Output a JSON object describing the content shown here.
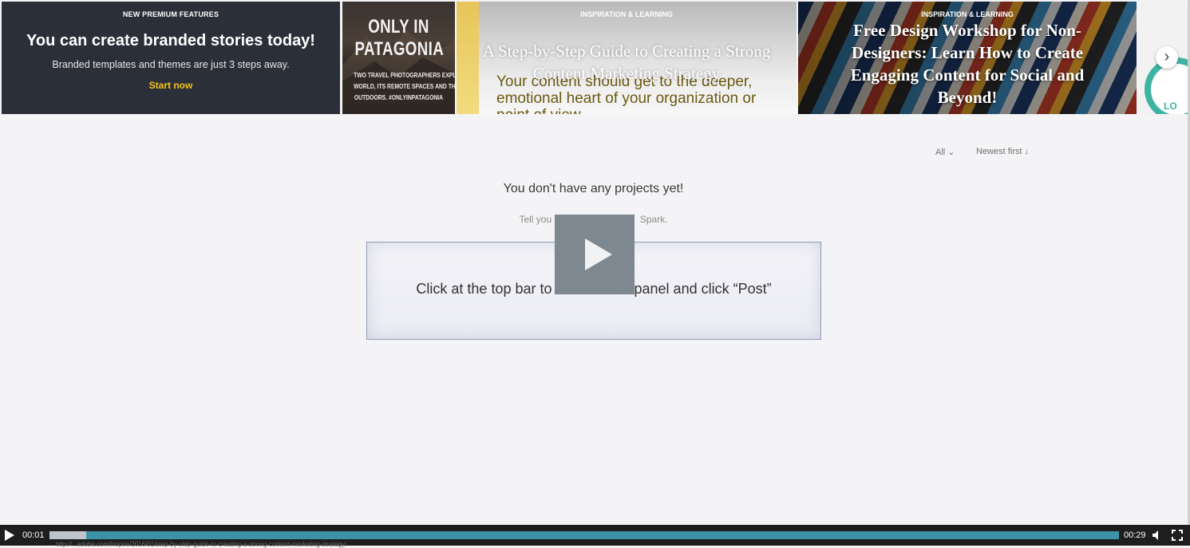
{
  "carousel": {
    "promo": {
      "eyebrow": "NEW PREMIUM FEATURES",
      "title": "You can create branded stories today!",
      "subtitle": "Branded templates and themes are just 3 steps away.",
      "cta": "Start now"
    },
    "patagonia": {
      "title_line1": "ONLY IN",
      "title_line2": "PATAGONIA",
      "sub_line1": "TWO TRAVEL PHOTOGRAPHERS EXPLORING THE",
      "sub_line2": "WORLD, ITS REMOTE SPACES AND THE GREAT",
      "sub_line3": "OUTDOORS. #ONLYINPATAGONIA"
    },
    "guide": {
      "eyebrow": "INSPIRATION & LEARNING",
      "title": "A Step-by-Step Guide to Creating a Strong Content Marketing Strategy",
      "quote": "Your content should get to the deeper, emotional heart of your organization or point of view."
    },
    "workshop": {
      "eyebrow": "INSPIRATION & LEARNING",
      "title": "Free Design Workshop for Non-Designers: Learn How to Create Engaging Content for Social and Beyond!"
    },
    "next": {
      "lo_text": "LO",
      "arrow_icon": "chevron-right-icon"
    }
  },
  "sort": {
    "filter_label": "All",
    "order_label": "Newest first"
  },
  "empty": {
    "title": "You don't have any projects yet!",
    "subtitle_left": "Tell you",
    "subtitle_right": "Spark."
  },
  "tip": {
    "text_left": "Click at the top bar to re",
    "text_right": "ce panel and click “Post”"
  },
  "video": {
    "current_time": "00:01",
    "duration": "00:29",
    "buffered_fraction": 0.034,
    "progress_fraction": 0.0,
    "status_url": "http://...adobe.com/inspire/2016/01/step-by-step-guide-to-creating-a-strong-content-marketing-strategy/"
  },
  "colors": {
    "accent_yellow": "#f5c518",
    "progress_teal": "#3c93a7",
    "play_overlay": "#7d8891"
  }
}
